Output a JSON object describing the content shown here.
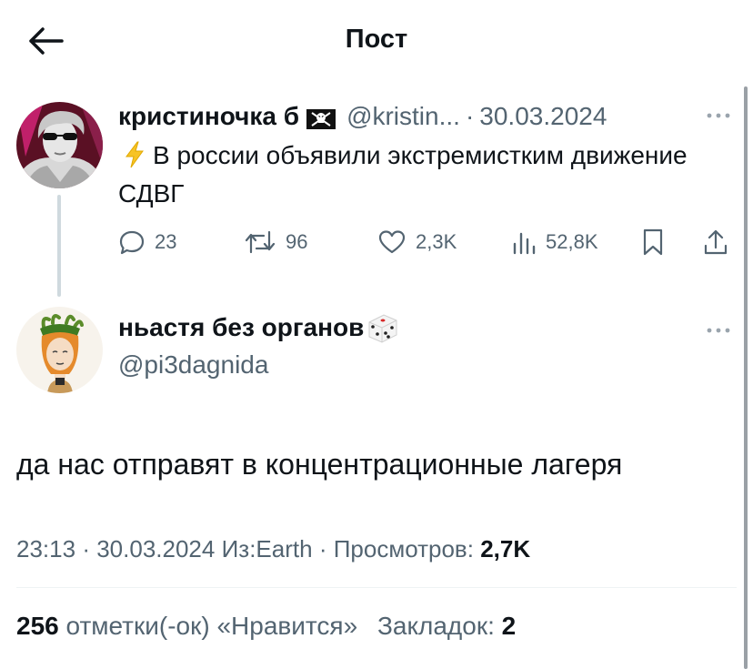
{
  "header": {
    "title": "Пост",
    "back_icon": "arrow-left-icon"
  },
  "parent_tweet": {
    "author_name": "кристиночка б",
    "handle": "@kristin...",
    "separator": "·",
    "date": "30.03.2024",
    "emoji_icon": "lightning-bolt-icon",
    "text": "В россии объявили экстремистким движение СДВГ",
    "actions": {
      "replies": "23",
      "retweets": "96",
      "likes": "2,3K",
      "views": "52,8K"
    }
  },
  "main_tweet": {
    "author_name": "ньастя без органов",
    "handle": "@pi3dagnida",
    "text": "да нас отправят в концентрационные лагеря",
    "meta": {
      "time": "23:13",
      "sep1": "·",
      "date": "30.03.2024",
      "source": "Из:Earth",
      "sep2": "·",
      "views_label": "Просмотров:",
      "views_value": "2,7K"
    },
    "stats": {
      "likes_count": "256",
      "likes_label": "отметки(-ок) «Нравится»",
      "bookmarks_label": "Закладок:",
      "bookmarks_count": "2"
    }
  },
  "colors": {
    "text": "#0f1419",
    "muted": "#536471",
    "bolt": "#f7c325",
    "divider": "#eff3f4"
  }
}
